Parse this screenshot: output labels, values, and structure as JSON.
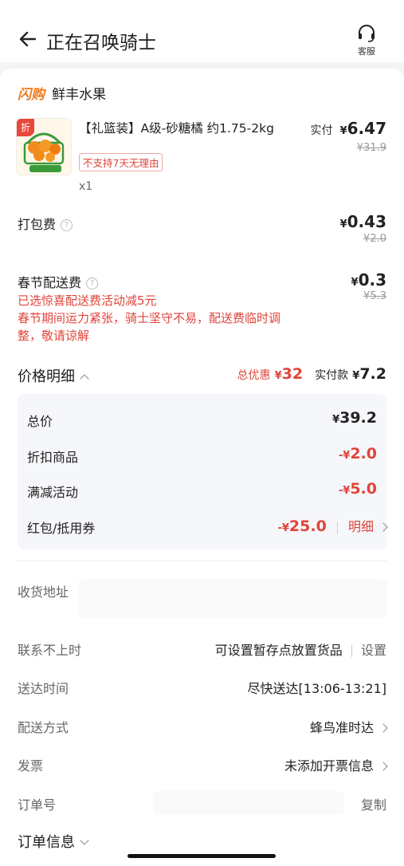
{
  "header": {
    "title": "正在召唤骑士",
    "service_label": "客服"
  },
  "shop": {
    "logo": "闪购",
    "name": "鲜丰水果"
  },
  "product": {
    "badge": "折",
    "name": "【礼篮装】A级-砂糖橘 约1.75-2kg",
    "tag": "不支持7天无理由",
    "qty": "x1",
    "paid_label": "实付",
    "currency": "¥",
    "price": "6.47",
    "original_price": "¥31.9"
  },
  "packing": {
    "label": "打包费",
    "currency": "¥",
    "price": "0.43",
    "original_price": "¥2.0"
  },
  "delivery_fee": {
    "label": "春节配送费",
    "note1": "已选惊喜配送费活动减5元",
    "note2": "春节期间运力紧张，骑士坚守不易，配送费临时调整，敬请谅解",
    "currency": "¥",
    "price": "0.3",
    "original_price": "¥5.3"
  },
  "price_detail": {
    "label": "价格明细",
    "total_discount_label": "总优惠",
    "total_discount_currency": "¥",
    "total_discount": "32",
    "paid_label": "实付款",
    "paid_currency": "¥",
    "paid": "7.2",
    "rows": [
      {
        "label": "总价",
        "currency": "¥",
        "value": "39.2"
      },
      {
        "label": "折扣商品",
        "currency": "-¥",
        "value": "2.0"
      },
      {
        "label": "满减活动",
        "currency": "-¥",
        "value": "5.0"
      },
      {
        "label": "红包/抵用券",
        "currency": "-¥",
        "value": "25.0",
        "link": "明细"
      }
    ]
  },
  "info": {
    "address_label": "收货地址",
    "unreachable_label": "联系不上时",
    "unreachable_value": "可设置暂存点放置货品",
    "unreachable_action": "设置",
    "time_label": "送达时间",
    "time_value": "尽快送达[13:06-13:21]",
    "method_label": "配送方式",
    "method_value": "蜂鸟准时达",
    "invoice_label": "发票",
    "invoice_value": "未添加开票信息",
    "order_no_label": "订单号",
    "order_no_action": "复制",
    "order_info_label": "订单信息"
  },
  "colors": {
    "accent_red": "#e0443a",
    "brand_orange": "#f07a1c"
  }
}
